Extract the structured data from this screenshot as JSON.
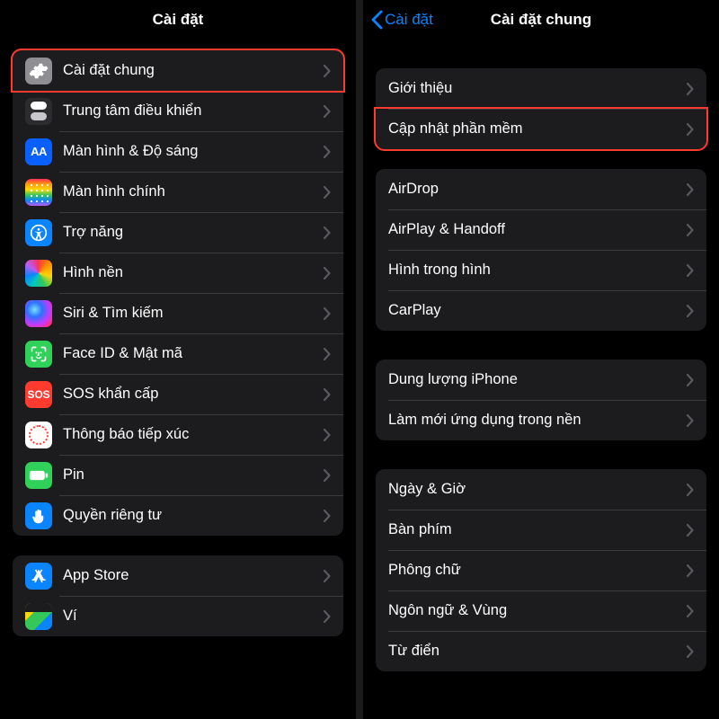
{
  "colors": {
    "accent": "#0a84ff",
    "highlight": "#ff3b2f"
  },
  "left": {
    "nav_title": "Cài đặt",
    "groups": [
      {
        "id": "main",
        "items": [
          {
            "id": "general",
            "label": "Cài đặt chung",
            "icon": "gear",
            "highlight": true
          },
          {
            "id": "controlcenter",
            "label": "Trung tâm điều khiển",
            "icon": "control-center"
          },
          {
            "id": "display",
            "label": "Màn hình & Độ sáng",
            "icon": "text-aa"
          },
          {
            "id": "homescreen",
            "label": "Màn hình chính",
            "icon": "app-grid"
          },
          {
            "id": "accessibility",
            "label": "Trợ năng",
            "icon": "accessibility"
          },
          {
            "id": "wallpaper",
            "label": "Hình nền",
            "icon": "wallpaper"
          },
          {
            "id": "siri",
            "label": "Siri & Tìm kiếm",
            "icon": "siri"
          },
          {
            "id": "faceid",
            "label": "Face ID & Mật mã",
            "icon": "faceid"
          },
          {
            "id": "sos",
            "label": "SOS khẩn cấp",
            "icon": "sos"
          },
          {
            "id": "exposure",
            "label": "Thông báo tiếp xúc",
            "icon": "exposure"
          },
          {
            "id": "battery",
            "label": "Pin",
            "icon": "battery"
          },
          {
            "id": "privacy",
            "label": "Quyền riêng tư",
            "icon": "hand"
          }
        ]
      },
      {
        "id": "store",
        "items": [
          {
            "id": "appstore",
            "label": "App Store",
            "icon": "appstore"
          },
          {
            "id": "wallet",
            "label": "Ví",
            "icon": "wallet"
          }
        ]
      }
    ]
  },
  "right": {
    "nav_title": "Cài đặt chung",
    "back_label": "Cài đặt",
    "groups": [
      {
        "id": "about",
        "items": [
          {
            "id": "about",
            "label": "Giới thiệu"
          },
          {
            "id": "update",
            "label": "Cập nhật phần mềm",
            "highlight": true
          }
        ]
      },
      {
        "id": "connect",
        "items": [
          {
            "id": "airdrop",
            "label": "AirDrop"
          },
          {
            "id": "airplay",
            "label": "AirPlay & Handoff"
          },
          {
            "id": "pip",
            "label": "Hình trong hình"
          },
          {
            "id": "carplay",
            "label": "CarPlay"
          }
        ]
      },
      {
        "id": "storage",
        "items": [
          {
            "id": "storage",
            "label": "Dung lượng iPhone"
          },
          {
            "id": "bgapp",
            "label": "Làm mới ứng dụng trong nền"
          }
        ]
      },
      {
        "id": "lang",
        "items": [
          {
            "id": "datetime",
            "label": "Ngày & Giờ"
          },
          {
            "id": "keyboard",
            "label": "Bàn phím"
          },
          {
            "id": "fonts",
            "label": "Phông chữ"
          },
          {
            "id": "language",
            "label": "Ngôn ngữ & Vùng"
          },
          {
            "id": "dictionary",
            "label": "Từ điển"
          }
        ]
      }
    ]
  }
}
